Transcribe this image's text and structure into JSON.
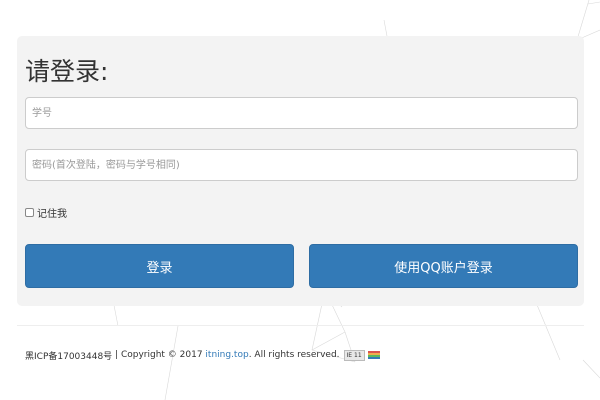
{
  "login": {
    "heading": "请登录:",
    "username_placeholder": "学号",
    "password_placeholder": "密码(首次登陆，密码与学号相同)",
    "remember_label": "记住我",
    "login_button": "登录",
    "qq_button": "使用QQ账户登录"
  },
  "footer": {
    "icp": "黑ICP备17003448号",
    "separator": " | ",
    "copyright_prefix": "Copyright © 2017 ",
    "site_link": "itning.top",
    "copyright_suffix": ". All rights reserved.",
    "badge_text": "IE 11"
  },
  "colors": {
    "primary": "#337ab7",
    "panel_bg": "#f3f3f3"
  }
}
